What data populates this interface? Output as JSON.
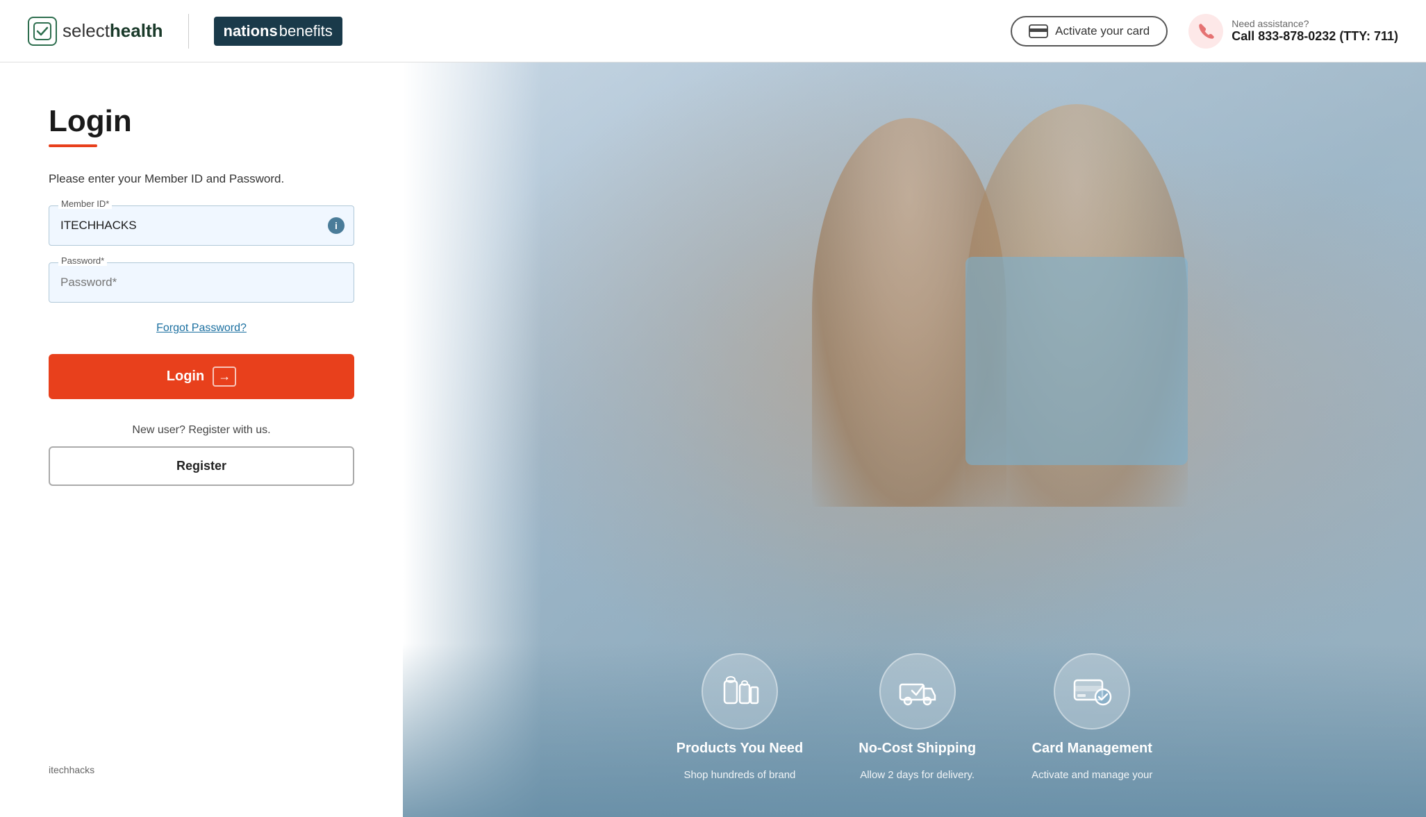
{
  "header": {
    "selecthealth_brand": "select",
    "selecthealth_brand_bold": "health",
    "nations_brand": "nations",
    "benefits_brand": "benefits",
    "activate_card_label": "Activate your card",
    "need_assistance_label": "Need assistance?",
    "phone_number": "Call  833-878-0232 (TTY: 711)"
  },
  "login": {
    "title": "Login",
    "subtitle": "Please enter your Member ID and Password.",
    "member_id_label": "Member ID*",
    "member_id_value": "ITECHHACKS",
    "password_label": "Password*",
    "password_placeholder": "Password*",
    "forgot_password_label": "Forgot Password?",
    "login_button_label": "Login",
    "new_user_text": "New user? Register with us.",
    "register_button_label": "Register"
  },
  "footer": {
    "watermark": "itechhacks"
  },
  "features": [
    {
      "icon": "products-icon",
      "title": "Products You Need",
      "description": "Shop hundreds of brand"
    },
    {
      "icon": "shipping-icon",
      "title": "No-Cost Shipping",
      "description": "Allow 2 days for delivery."
    },
    {
      "icon": "card-management-icon",
      "title": "Card Management",
      "description": "Activate and manage your"
    }
  ]
}
